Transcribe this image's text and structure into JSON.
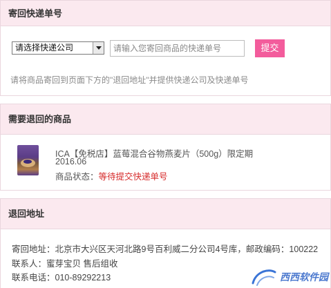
{
  "tracking": {
    "title": "寄回快递单号",
    "courier_select": "请选择快递公司",
    "tracking_placeholder": "请输入您寄回商品的快递单号",
    "submit_label": "提交",
    "hint": "请将商品寄回到页面下方的\"退回地址\"并提供快递公司及快递单号"
  },
  "items": {
    "title": "需要退回的商品",
    "product": {
      "name_line1": "ICA【免税店】蓝莓混合谷物燕麦片（500g）限定期",
      "name_line2": "2016.06",
      "status_label": "商品状态：",
      "status_value": "等待提交快递单号"
    }
  },
  "address": {
    "title": "退回地址",
    "address_label": "寄回地址：",
    "address_value": "北京市大兴区天河北路9号百利威二分公司4号库，邮政编码：100222",
    "contact_label": "联系人：",
    "contact_value": "蜜芽宝贝 售后组收",
    "phone_label": "联系电话：",
    "phone_value": "010-89292213"
  },
  "watermark": {
    "text": "西西软件园"
  },
  "colors": {
    "panel_header_bg": "#fbe9ef",
    "panel_border": "#ead6de",
    "accent_button": "#f35c9c",
    "status_red": "#d62b2b"
  }
}
